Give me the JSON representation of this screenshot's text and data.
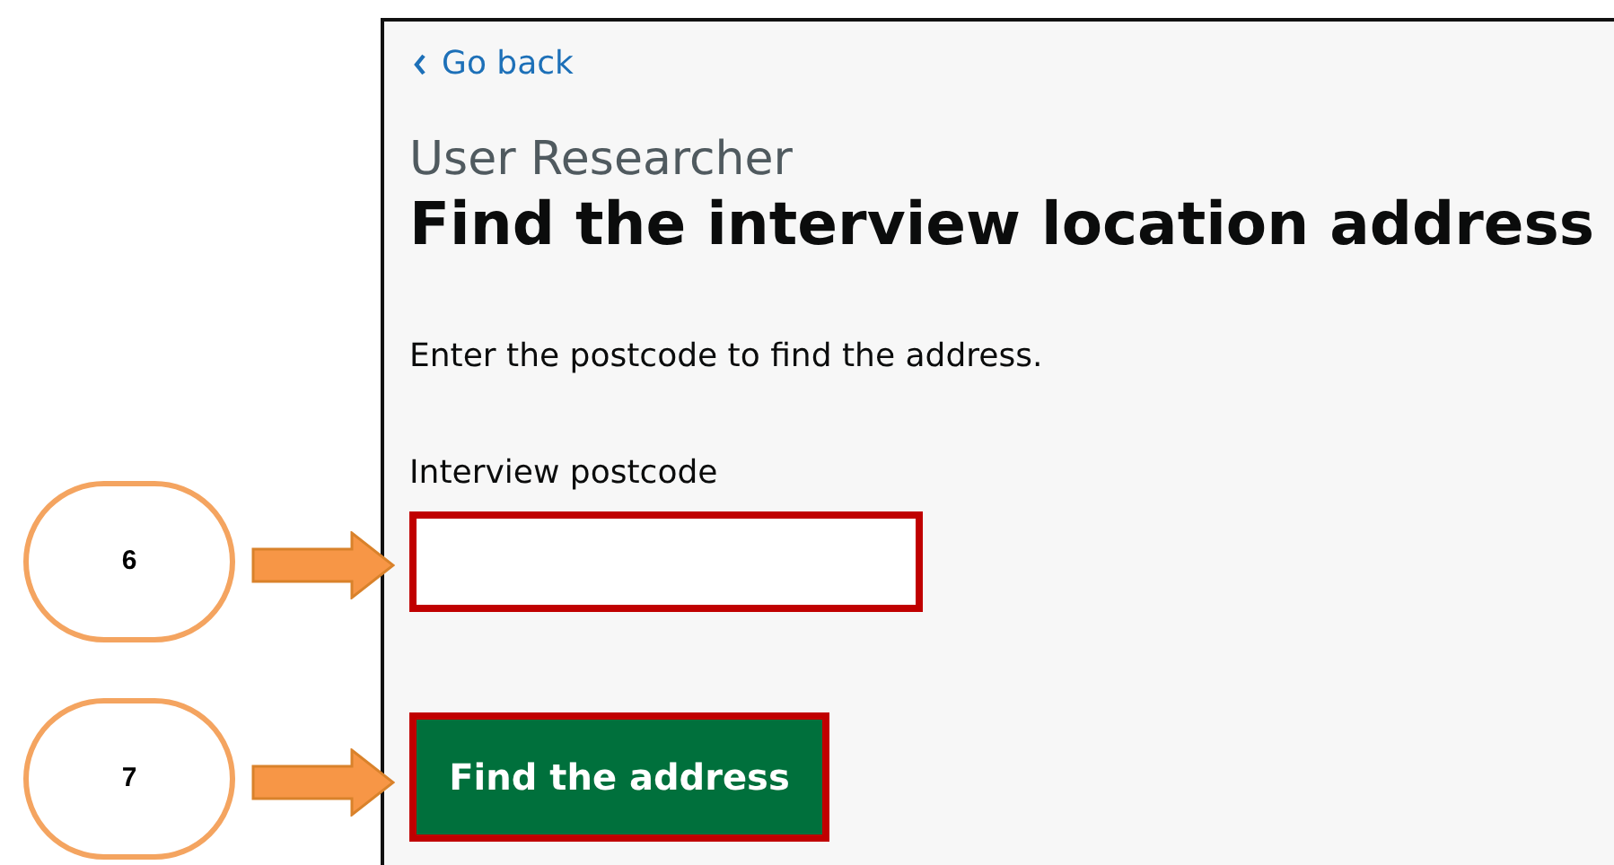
{
  "back_link": {
    "label": "Go back"
  },
  "caption": "User Researcher",
  "heading": "Find the interview location address",
  "hint": "Enter the postcode to find the address.",
  "postcode_field": {
    "label": "Interview postcode",
    "highlighted": true
  },
  "submit_button": {
    "label": "Find the address",
    "highlighted": true
  },
  "annotations": [
    {
      "label": "6"
    },
    {
      "label": "7"
    }
  ]
}
